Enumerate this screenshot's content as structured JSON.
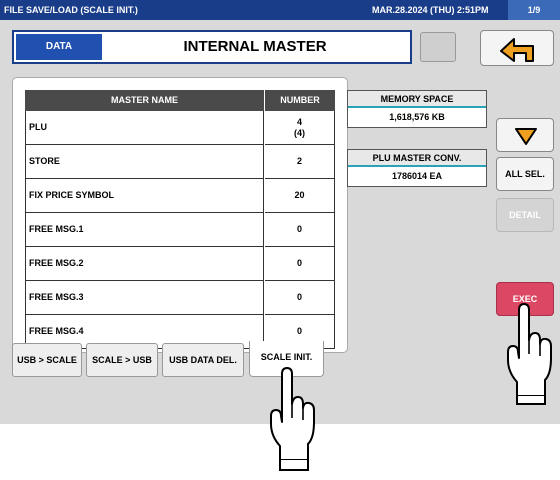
{
  "titlebar": {
    "title": "FILE SAVE/LOAD (SCALE INIT.)",
    "datetime": "MAR.28.2024 (THU)  2:51PM",
    "page": "1/9"
  },
  "header": {
    "data_tab": "DATA",
    "title": "INTERNAL MASTER",
    "back_icon": "back-arrow-icon"
  },
  "table": {
    "columns": [
      "MASTER NAME",
      "NUMBER"
    ],
    "rows": [
      {
        "name": "PLU",
        "number": "4",
        "sub": "(4)"
      },
      {
        "name": "STORE",
        "number": "2",
        "sub": ""
      },
      {
        "name": "FIX PRICE SYMBOL",
        "number": "20",
        "sub": ""
      },
      {
        "name": "FREE MSG.1",
        "number": "0",
        "sub": ""
      },
      {
        "name": "FREE MSG.2",
        "number": "0",
        "sub": ""
      },
      {
        "name": "FREE MSG.3",
        "number": "0",
        "sub": ""
      },
      {
        "name": "FREE MSG.4",
        "number": "0",
        "sub": ""
      }
    ]
  },
  "memory": {
    "label": "MEMORY SPACE",
    "value": "1,618,576 KB"
  },
  "plu_conv": {
    "label": "PLU MASTER CONV.",
    "value": "1786014 EA"
  },
  "side": {
    "down_icon": "triangle-down-icon",
    "all_sel": "ALL SEL.",
    "detail": "DETAIL",
    "exec": "EXEC"
  },
  "tabs": [
    {
      "label": "USB > SCALE"
    },
    {
      "label": "SCALE > USB"
    },
    {
      "label": "USB DATA DEL."
    },
    {
      "label": "SCALE INIT."
    }
  ],
  "colors": {
    "titlebar": "#1a3d8a",
    "accent_blue": "#2050b0",
    "exec_red": "#dc4764",
    "arrow_orange": "#f0a020",
    "teal": "#29a3b8"
  }
}
